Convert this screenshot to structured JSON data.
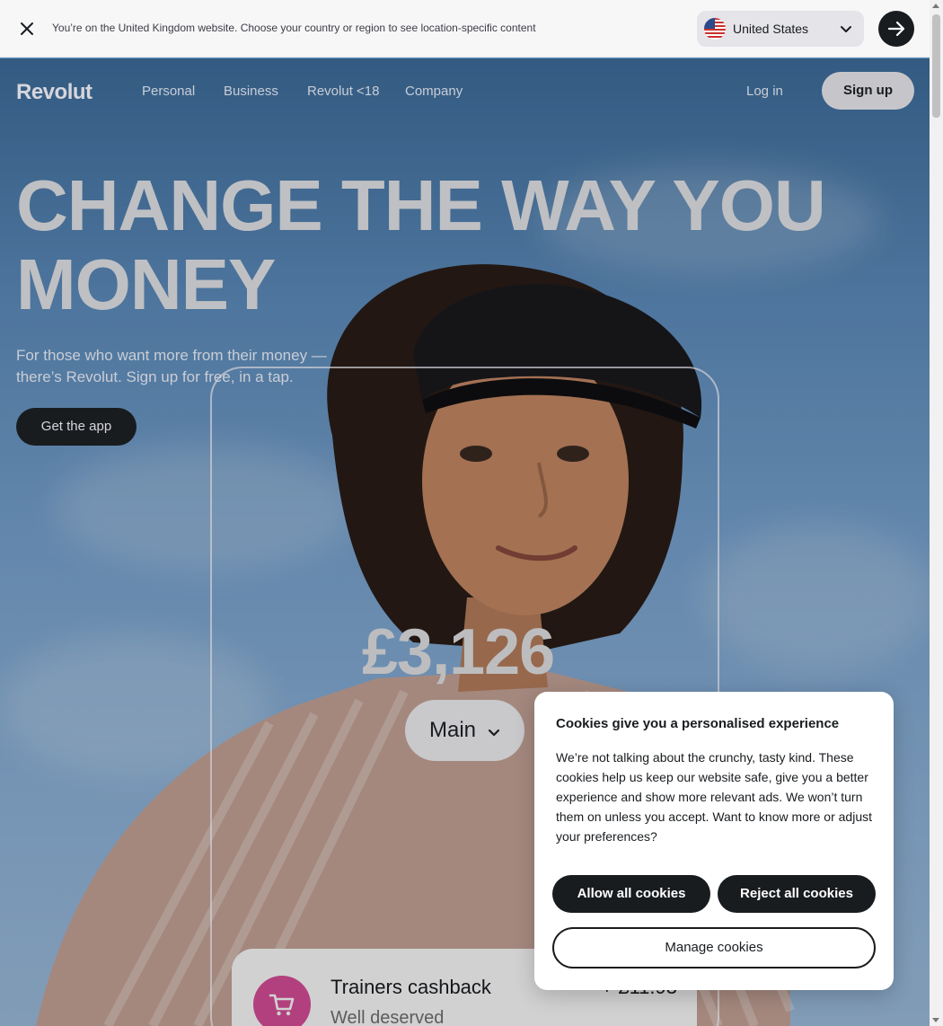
{
  "banner": {
    "message": "You’re on the United Kingdom website. Choose your country or region to see location-specific content",
    "country": "United States"
  },
  "nav": {
    "logo": "Revolut",
    "links": [
      "Personal",
      "Business",
      "Revolut <18",
      "Company"
    ],
    "login": "Log in",
    "signup": "Sign up"
  },
  "hero": {
    "headline_line1": "CHANGE THE WAY YOU",
    "headline_line2": "MONEY",
    "subhead": "For those who want more from their money — there’s Revolut. Sign up for free, in a tap.",
    "cta": "Get the app",
    "balance": "£3,126",
    "account": "Main",
    "transaction": {
      "title": "Trainers cashback",
      "subtitle": "Well deserved",
      "amount": "+ £11.93"
    }
  },
  "cookie": {
    "title": "Cookies give you a personalised experience",
    "body": "We’re not talking about the crunchy, tasty kind. These cookies help us keep our website safe, give you a better experience and show more relevant ads. We won’t turn them on unless you accept. Want to know more or adjust your preferences?",
    "allow": "Allow all cookies",
    "reject": "Reject all cookies",
    "manage": "Manage cookies"
  },
  "icons": {
    "close": "close-icon",
    "flag": "us-flag-icon",
    "chevron": "chevron-down-icon",
    "arrow": "arrow-right-icon",
    "cart": "shopping-cart-icon"
  },
  "colors": {
    "dark": "#191c1f",
    "cashback_icon": "#d94f9b"
  }
}
